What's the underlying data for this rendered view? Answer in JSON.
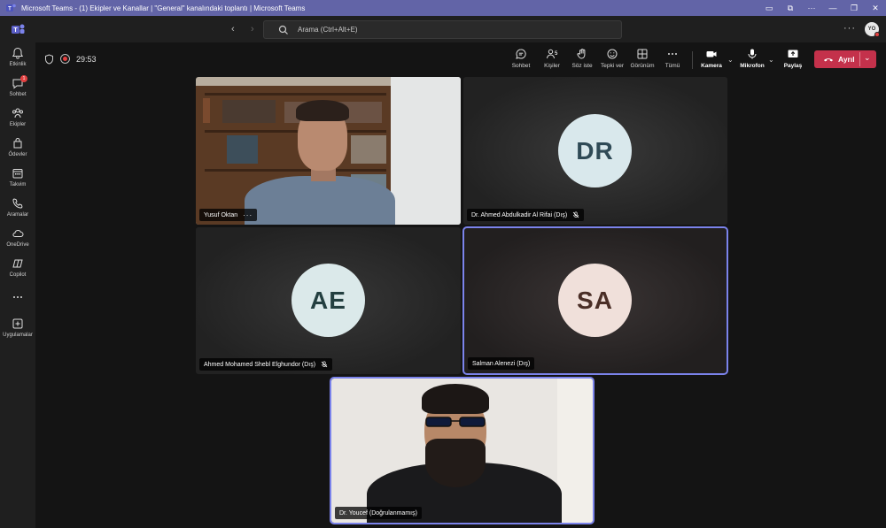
{
  "window": {
    "title": "Microsoft Teams - (1) Ekipler ve Kanallar | \"General\" kanalındaki toplantı | Microsoft Teams"
  },
  "topbar": {
    "search_placeholder": "Arama (Ctrl+Alt+E)",
    "more": "···",
    "avatar_initials": "YO"
  },
  "sidebar": {
    "items": [
      {
        "label": "Etkinlik",
        "icon": "bell-icon"
      },
      {
        "label": "Sohbet",
        "icon": "chat-icon",
        "badge": "1"
      },
      {
        "label": "Ekipler",
        "icon": "teams-icon"
      },
      {
        "label": "Ödevler",
        "icon": "assignments-icon"
      },
      {
        "label": "Takvim",
        "icon": "calendar-icon"
      },
      {
        "label": "Aramalar",
        "icon": "phone-icon"
      },
      {
        "label": "OneDrive",
        "icon": "cloud-icon"
      },
      {
        "label": "Copilot",
        "icon": "copilot-icon"
      },
      {
        "label": "",
        "icon": "more-icon"
      },
      {
        "label": "Uygulamalar",
        "icon": "apps-icon"
      }
    ]
  },
  "toolbar": {
    "timer": "29:53",
    "chat": "Sohbet",
    "people": "Kişiler",
    "people_count": "5",
    "raise": "Söz iste",
    "react": "Tepki ver",
    "view": "Görünüm",
    "more": "Tümü",
    "camera": "Kamera",
    "mic": "Mikrofon",
    "share": "Paylaş",
    "leave": "Ayrıl"
  },
  "participants": [
    {
      "name": "Yusuf Oktan",
      "type": "video"
    },
    {
      "name": "Dr. Ahmed Abdulkadir Al Rifai (Dış)",
      "initials": "DR",
      "muted": true
    },
    {
      "name": "Ahmed Mohamed Shebl Elghundor (Dış)",
      "initials": "AE",
      "muted": true
    },
    {
      "name": "Salman Alenezi (Dış)",
      "initials": "SA",
      "muted": false,
      "speaking": true
    },
    {
      "name": "Dr. Youcef (Doğrulanmamış)",
      "type": "video",
      "speaking": true
    }
  ],
  "colors": {
    "brand": "#6264a7",
    "leave": "#c4314b",
    "active_outline": "#7b83eb",
    "avatar_dr_bg": "#d9e8ec",
    "avatar_dr_fg": "#2f4a56",
    "avatar_ae_bg": "#dbe9ea",
    "avatar_ae_fg": "#233f40",
    "avatar_sa_bg": "#f0e0da",
    "avatar_sa_fg": "#4a2e26"
  }
}
